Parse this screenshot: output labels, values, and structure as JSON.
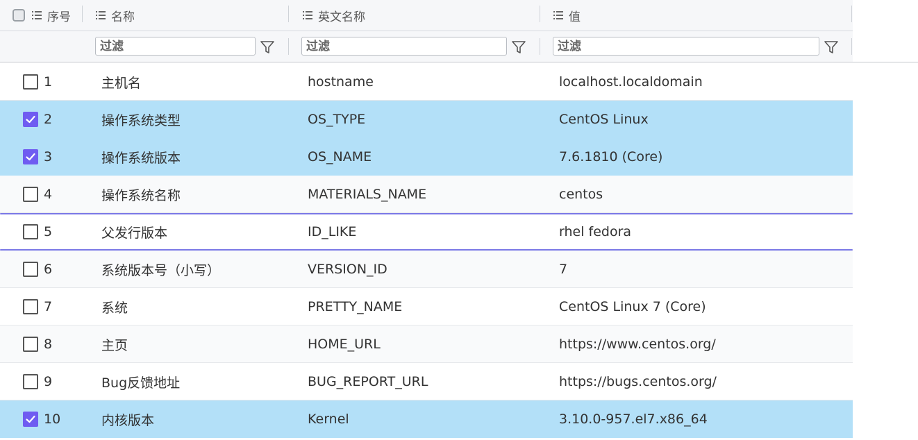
{
  "columns": {
    "index": "序号",
    "name": "名称",
    "english_name": "英文名称",
    "value": "值"
  },
  "filter_placeholder": "过滤",
  "rows": [
    {
      "index": "1",
      "name": "主机名",
      "english_name": "hostname",
      "value": "localhost.localdomain",
      "checked": false
    },
    {
      "index": "2",
      "name": "操作系统类型",
      "english_name": "OS_TYPE",
      "value": "CentOS Linux",
      "checked": true
    },
    {
      "index": "3",
      "name": "操作系统版本",
      "english_name": "OS_NAME",
      "value": "7.6.1810 (Core)",
      "checked": true
    },
    {
      "index": "4",
      "name": "操作系统名称",
      "english_name": "MATERIALS_NAME",
      "value": "centos",
      "checked": false
    },
    {
      "index": "5",
      "name": "父发行版本",
      "english_name": "ID_LIKE",
      "value": "rhel fedora",
      "checked": false
    },
    {
      "index": "6",
      "name": "系统版本号（小写）",
      "english_name": "VERSION_ID",
      "value": "7",
      "checked": false
    },
    {
      "index": "7",
      "name": "系统",
      "english_name": "PRETTY_NAME",
      "value": "CentOS Linux 7 (Core)",
      "checked": false
    },
    {
      "index": "8",
      "name": "主页",
      "english_name": "HOME_URL",
      "value": "https://www.centos.org/",
      "checked": false
    },
    {
      "index": "9",
      "name": "Bug反馈地址",
      "english_name": "BUG_REPORT_URL",
      "value": "https://bugs.centos.org/",
      "checked": false
    },
    {
      "index": "10",
      "name": "内核版本",
      "english_name": "Kernel",
      "value": "3.10.0-957.el7.x86_64",
      "checked": true
    }
  ],
  "colors": {
    "selected_row": "#b3e0f8",
    "checkbox_checked": "#6f5cf1",
    "focus_line": "#7a78e6"
  }
}
